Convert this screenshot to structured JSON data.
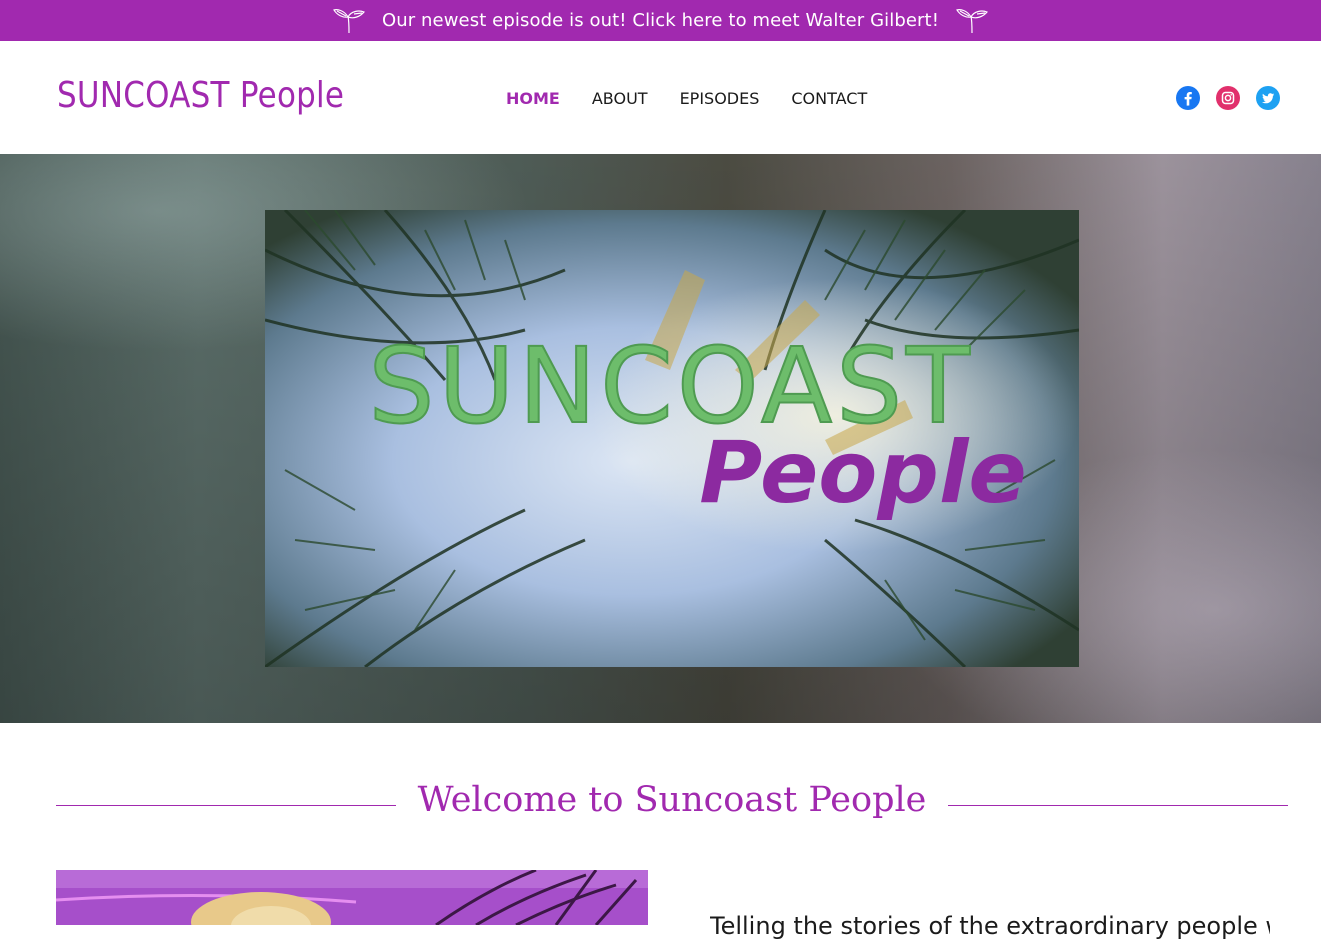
{
  "banner": {
    "text": "Our newest episode is out! Click here to meet Walter Gilbert!",
    "icon": "sprout-icon"
  },
  "header": {
    "logo": "SUNCOAST People",
    "nav": [
      {
        "label": "HOME",
        "active": true
      },
      {
        "label": "ABOUT",
        "active": false
      },
      {
        "label": "EPISODES",
        "active": false
      },
      {
        "label": "CONTACT",
        "active": false
      }
    ],
    "social": [
      {
        "name": "facebook-icon",
        "color": "#1877f2"
      },
      {
        "name": "instagram-icon",
        "color": "#e1306c"
      },
      {
        "name": "twitter-icon",
        "color": "#1da1f2"
      }
    ]
  },
  "hero": {
    "image_text_1": "SUNCOAST",
    "image_text_2": "People"
  },
  "welcome": {
    "title": "Welcome to Suncoast People"
  },
  "intro": {
    "text": "Telling the stories of the extraordinary people wh"
  },
  "colors": {
    "brand": "#a129af",
    "logo_green": "#6dbd6b",
    "nav_text": "#1b1b1b"
  }
}
